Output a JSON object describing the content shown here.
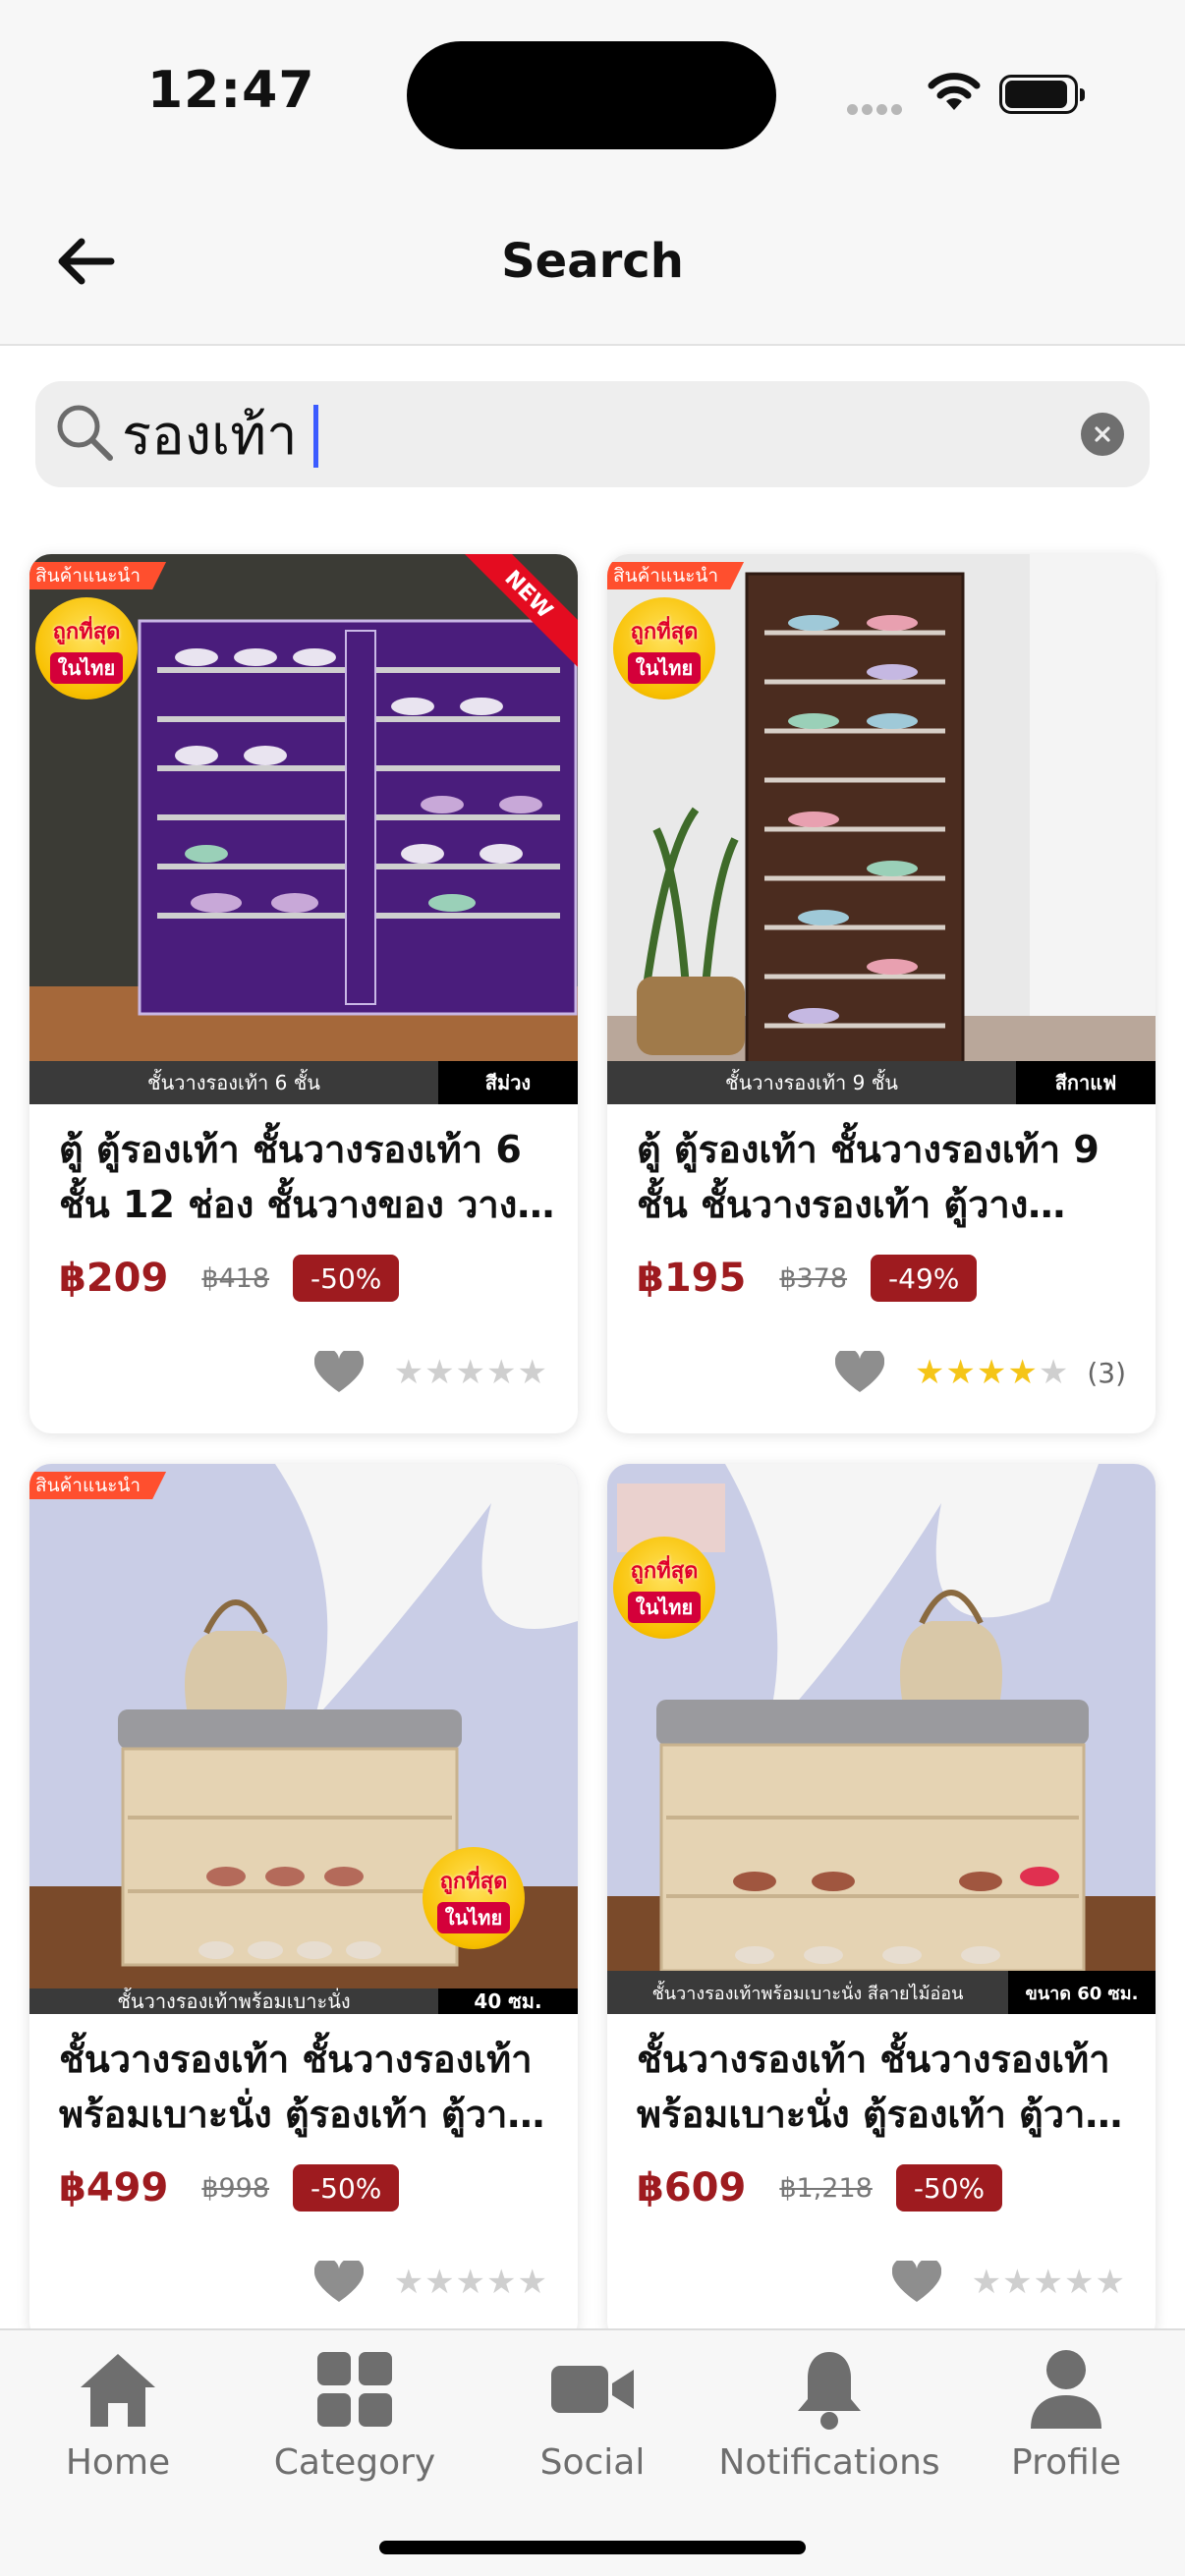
{
  "status_bar": {
    "time": "12:47"
  },
  "header": {
    "title": "Search"
  },
  "search": {
    "value": "รองเท้า",
    "placeholder": ""
  },
  "products": [
    {
      "title": "ตู้ ตู้รองเท้า ชั้นวางรองเท้า 6 ชั้น 12 ช่อง ชั้นวางของ วางรองเท้า",
      "price": "฿209",
      "original_price": "฿418",
      "discount": "-50%",
      "rating": 0,
      "rating_count": "",
      "image": {
        "badge_recommended": "สินค้าแนะนำ",
        "badge_cheap_line1": "ถูกที่สุด",
        "badge_cheap_line2": "ในไทย",
        "ribbon": "NEW",
        "caption_left": "ชั้นวางรองเท้า 6 ชั้น",
        "caption_right": "สีม่วง",
        "bg_color": "#4a1d7c"
      }
    },
    {
      "title": "ตู้ ตู้รองเท้า ชั้นวางรองเท้า 9 ชั้น ชั้นวางรองเท้า ตู้วางรองเท้า",
      "price": "฿195",
      "original_price": "฿378",
      "discount": "-49%",
      "rating": 4,
      "rating_count": "(3)",
      "image": {
        "badge_recommended": "สินค้าแนะนำ",
        "badge_cheap_line1": "ถูกที่สุด",
        "badge_cheap_line2": "ในไทย",
        "caption_left": "ชั้นวางรองเท้า 9 ชั้น",
        "caption_right": "สีกาแฟ",
        "bg_color": "#4b2c1f"
      }
    },
    {
      "title": "ชั้นวางรองเท้า ชั้นวางรองเท้า พร้อมเบาะนั่ง ตู้รองเท้า ตู้วางรองเท้า",
      "price": "฿499",
      "original_price": "฿998",
      "discount": "-50%",
      "rating": 0,
      "rating_count": "",
      "image": {
        "badge_recommended": "สินค้าแนะนำ",
        "badge_cheap_line1": "ถูกที่สุด",
        "badge_cheap_line2": "ในไทย",
        "caption_left": "ชั้นวางรองเท้าพร้อมเบาะนั่ง",
        "caption_right": "40 ซม.",
        "bg_color": "#e5d3b3"
      }
    },
    {
      "title": "ชั้นวางรองเท้า ชั้นวางรองเท้า พร้อมเบาะนั่ง ตู้รองเท้า ตู้วางรองเท้า",
      "price": "฿609",
      "original_price": "฿1,218",
      "discount": "-50%",
      "rating": 0,
      "rating_count": "",
      "image": {
        "badge_cheap_line1": "ถูกที่สุด",
        "badge_cheap_line2": "ในไทย",
        "caption_left": "ชั้นวางรองเท้าพร้อมเบาะนั่ง สีลายไม้อ่อน",
        "caption_right": "ขนาด 60 ซม.",
        "bg_color": "#e5d3b3"
      }
    }
  ],
  "tabs": [
    {
      "label": "Home",
      "icon": "home-icon"
    },
    {
      "label": "Category",
      "icon": "grid-icon"
    },
    {
      "label": "Social",
      "icon": "video-camera-icon"
    },
    {
      "label": "Notifications",
      "icon": "bell-icon"
    },
    {
      "label": "Profile",
      "icon": "person-icon"
    }
  ],
  "colors": {
    "price": "#9e1b1f",
    "discount_bg": "#9e1b1f",
    "star": "#f5c518",
    "tab_icon": "#6e6e6e",
    "caret": "#3b5bff"
  }
}
